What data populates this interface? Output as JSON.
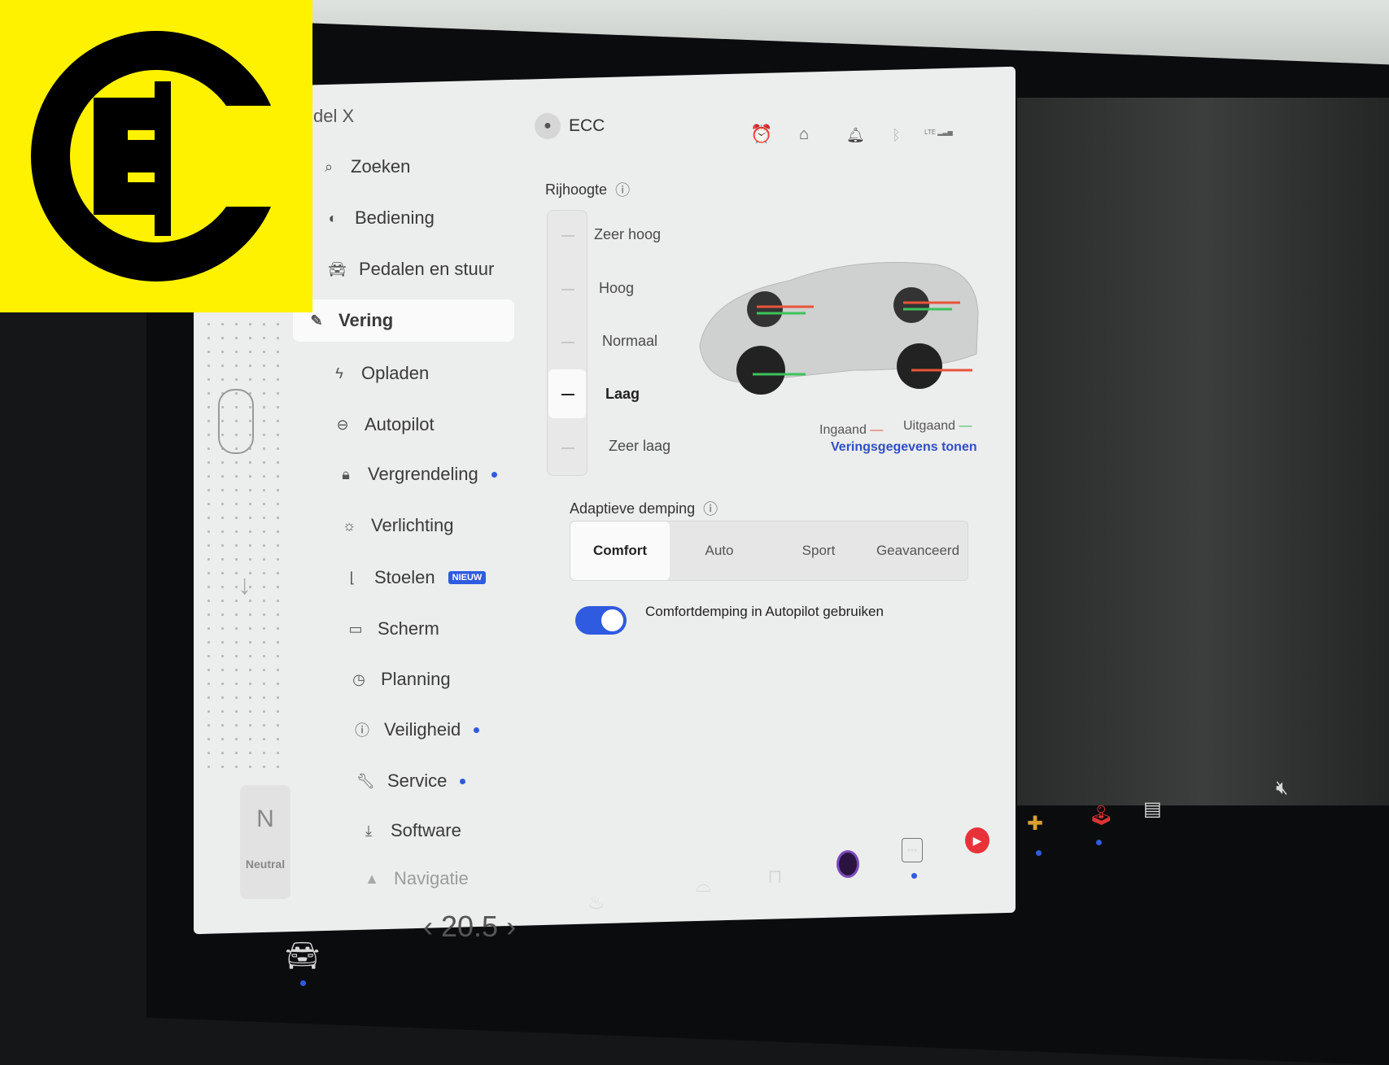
{
  "header": {
    "model": "del X",
    "profile": "ECC",
    "status_icons": [
      "alarm-icon",
      "garage-icon",
      "bell-icon",
      "bluetooth-icon",
      "lte-signal-icon"
    ],
    "lte": "LTE"
  },
  "sidebar": {
    "items": [
      {
        "label": "Zoeken",
        "icon": "search-icon"
      },
      {
        "label": "Bediening",
        "icon": "toggle-icon"
      },
      {
        "label": "Pedalen en stuur",
        "icon": "car-icon"
      },
      {
        "label": "Vering",
        "icon": "suspension-icon",
        "active": true
      },
      {
        "label": "Opladen",
        "icon": "bolt-icon"
      },
      {
        "label": "Autopilot",
        "icon": "steering-icon"
      },
      {
        "label": "Vergrendeling",
        "icon": "lock-icon",
        "dot": true
      },
      {
        "label": "Verlichting",
        "icon": "light-icon"
      },
      {
        "label": "Stoelen",
        "icon": "seat-icon",
        "badge": "NIEUW"
      },
      {
        "label": "Scherm",
        "icon": "screen-icon"
      },
      {
        "label": "Planning",
        "icon": "clock-icon"
      },
      {
        "label": "Veiligheid",
        "icon": "alert-icon",
        "dot": true
      },
      {
        "label": "Service",
        "icon": "wrench-icon",
        "dot": true
      },
      {
        "label": "Software",
        "icon": "download-icon"
      },
      {
        "label": "Navigatie",
        "icon": "navigation-icon"
      }
    ]
  },
  "gear": {
    "letter": "N",
    "label": "Neutral"
  },
  "ride_height": {
    "title": "Rijhoogte",
    "options": [
      "Zeer hoog",
      "Hoog",
      "Normaal",
      "Laag",
      "Zeer laag"
    ],
    "selected": "Laag",
    "legend": {
      "in": "Ingaand",
      "out": "Uitgaand",
      "in_color": "#e8553a",
      "out_color": "#3cc35a"
    },
    "link": "Veringsgegevens tonen"
  },
  "damping": {
    "title": "Adaptieve demping",
    "options": [
      "Comfort",
      "Auto",
      "Sport",
      "Geavanceerd"
    ],
    "selected": "Comfort"
  },
  "toggle": {
    "label": "Comfortdemping in Autopilot gebruiken",
    "on": true
  },
  "bottom_bar": {
    "temperature": "20.5",
    "icons": [
      "car-icon",
      "seat-heater-icon",
      "rear-defrost-icon",
      "front-defrost-icon",
      "camera-icon",
      "more-icon",
      "youtube-music-icon",
      "games-icon",
      "joystick-icon",
      "app-icon",
      "volume-mute-icon"
    ]
  },
  "colors": {
    "accent": "#2f5be0",
    "logo_bg": "#fff200",
    "alarm": "#f08a30"
  }
}
